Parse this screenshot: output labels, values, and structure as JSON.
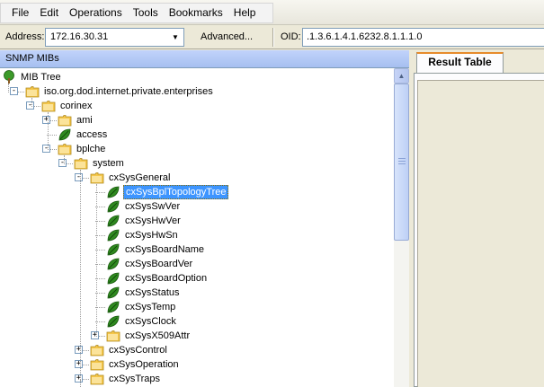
{
  "menu": [
    "File",
    "Edit",
    "Operations",
    "Tools",
    "Bookmarks",
    "Help"
  ],
  "address": {
    "label": "Address:",
    "value": "172.16.30.31",
    "advanced_label": "Advanced..."
  },
  "oid": {
    "label": "OID:",
    "value": ".1.3.6.1.4.1.6232.8.1.1.1.0"
  },
  "left_panel": {
    "title": "SNMP MIBs"
  },
  "tree": [
    {
      "label": "MIB Tree",
      "icon": "tree-icon",
      "depth": 0
    },
    {
      "label": "iso.org.dod.internet.private.enterprises",
      "icon": "folder-icon",
      "depth": 1,
      "expander": "-"
    },
    {
      "label": "corinex",
      "icon": "folder-icon",
      "depth": 2,
      "expander": "-"
    },
    {
      "label": "ami",
      "icon": "folder-icon",
      "depth": 3,
      "expander": "+"
    },
    {
      "label": "access",
      "icon": "leaf-icon",
      "depth": 3
    },
    {
      "label": "bplche",
      "icon": "folder-icon",
      "depth": 3,
      "expander": "-"
    },
    {
      "label": "system",
      "icon": "folder-icon",
      "depth": 4,
      "expander": "-"
    },
    {
      "label": "cxSysGeneral",
      "icon": "folder-icon",
      "depth": 5,
      "expander": "-"
    },
    {
      "label": "cxSysBplTopologyTree",
      "icon": "leaf-icon",
      "depth": 6,
      "selected": true
    },
    {
      "label": "cxSysSwVer",
      "icon": "leaf-icon",
      "depth": 6
    },
    {
      "label": "cxSysHwVer",
      "icon": "leaf-icon",
      "depth": 6
    },
    {
      "label": "cxSysHwSn",
      "icon": "leaf-icon",
      "depth": 6
    },
    {
      "label": "cxSysBoardName",
      "icon": "leaf-icon",
      "depth": 6
    },
    {
      "label": "cxSysBoardVer",
      "icon": "leaf-icon",
      "depth": 6
    },
    {
      "label": "cxSysBoardOption",
      "icon": "leaf-icon",
      "depth": 6
    },
    {
      "label": "cxSysStatus",
      "icon": "leaf-icon",
      "depth": 6
    },
    {
      "label": "cxSysTemp",
      "icon": "leaf-icon",
      "depth": 6
    },
    {
      "label": "cxSysClock",
      "icon": "leaf-icon",
      "depth": 6
    },
    {
      "label": "cxSysX509Attr",
      "icon": "folder-icon",
      "depth": 6,
      "expander": "+"
    },
    {
      "label": "cxSysControl",
      "icon": "folder-icon",
      "depth": 5,
      "expander": "+"
    },
    {
      "label": "cxSysOperation",
      "icon": "folder-icon",
      "depth": 5,
      "expander": "+"
    },
    {
      "label": "cxSysTraps",
      "icon": "folder-icon",
      "depth": 5,
      "expander": "+"
    }
  ],
  "right_panel": {
    "tab_label": "Result Table"
  },
  "colors": {
    "selection": "#3d95ff",
    "folder": "#f5c74a",
    "leaf": "#2f8a1f",
    "tab_accent": "#e68b2c"
  }
}
